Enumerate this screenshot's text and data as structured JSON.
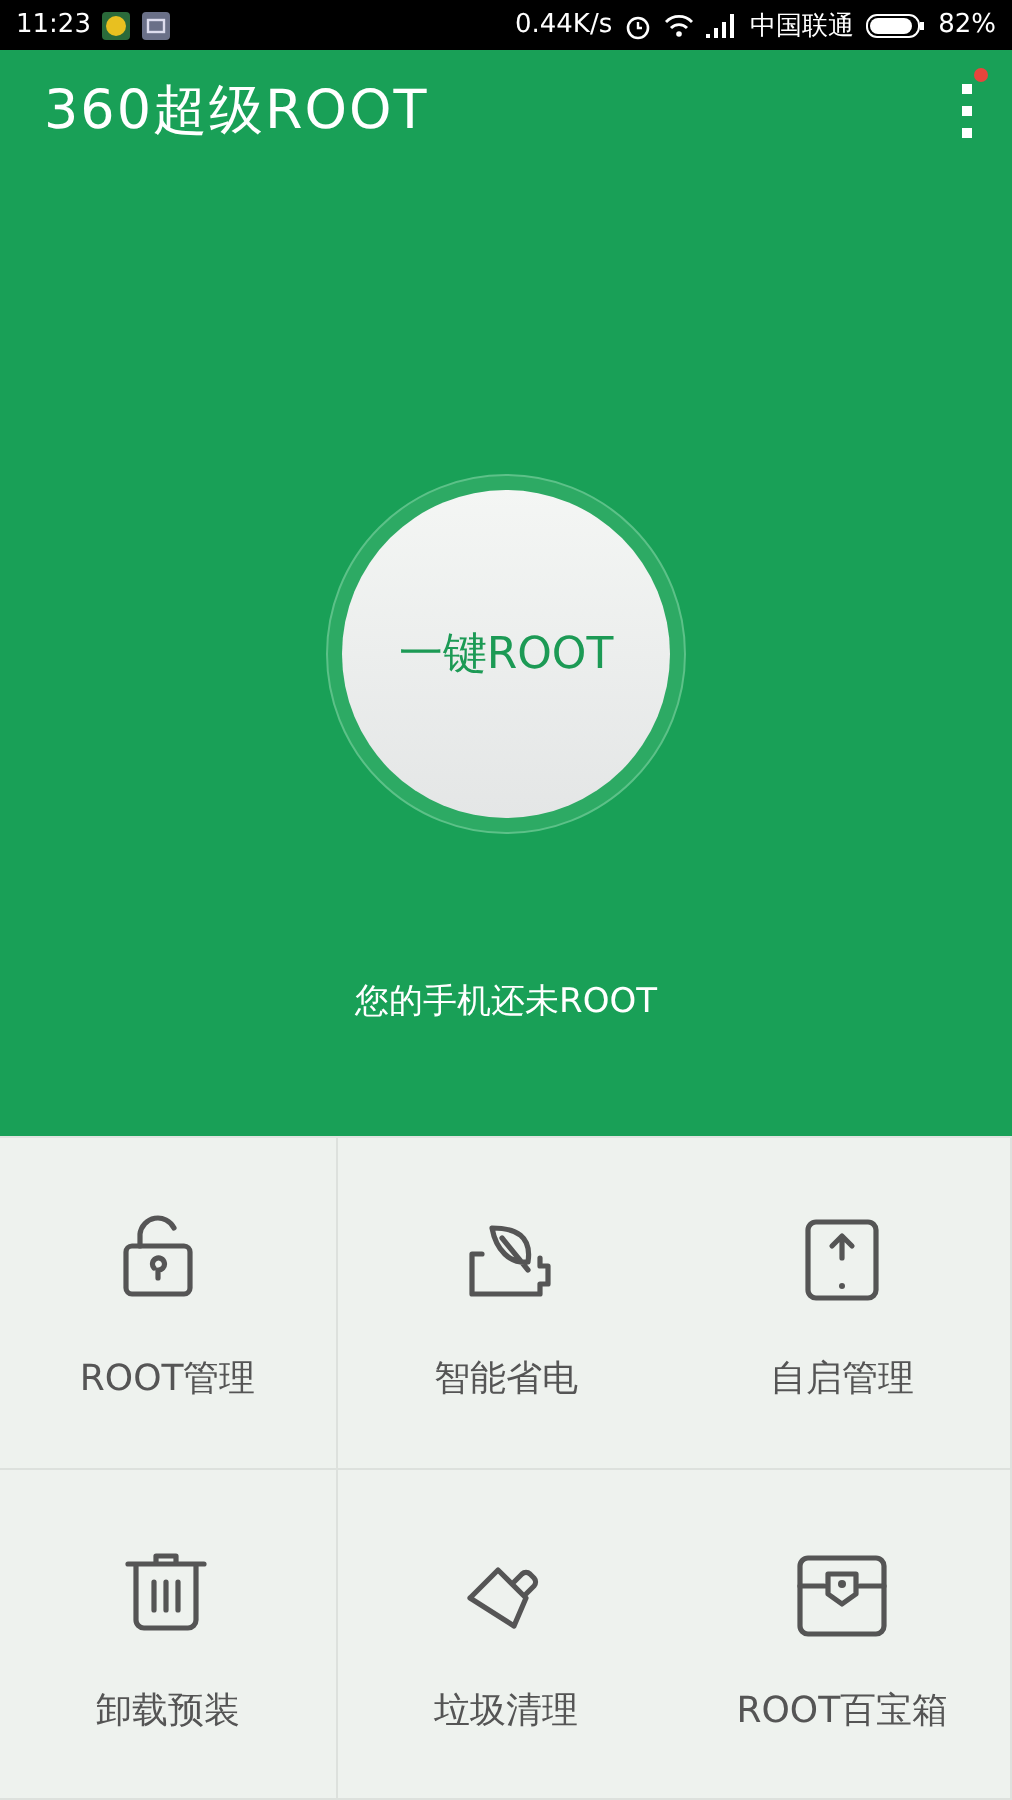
{
  "status_bar": {
    "time": "11:23",
    "speed": "0.44K/s",
    "carrier": "中国联通",
    "battery": "82%"
  },
  "app_bar": {
    "title": "360超级ROOT",
    "menu_badge": true
  },
  "main": {
    "button": "一键ROOT",
    "status": "您的手机还未ROOT"
  },
  "features": [
    {
      "label": "ROOT管理",
      "kind": "lock"
    },
    {
      "label": "智能省电",
      "kind": "battery"
    },
    {
      "label": "自启管理",
      "kind": "phone"
    },
    {
      "label": "卸载预装",
      "kind": "trash"
    },
    {
      "label": "垃圾清理",
      "kind": "brush"
    },
    {
      "label": "ROOT百宝箱",
      "kind": "chest"
    }
  ]
}
